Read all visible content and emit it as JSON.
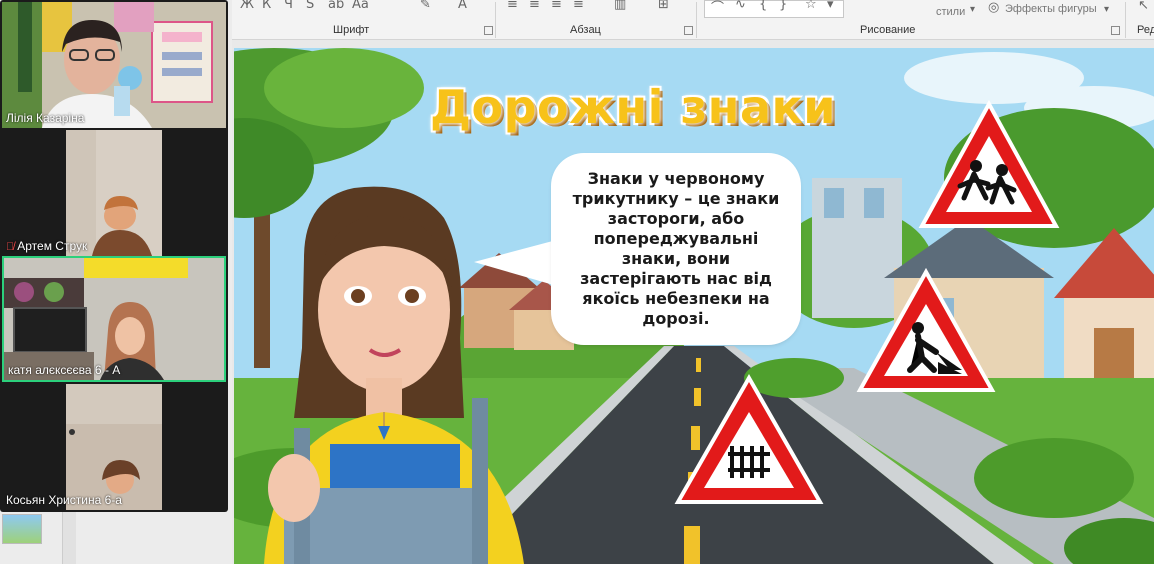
{
  "ribbon": {
    "groups": [
      {
        "label": "Шрифт"
      },
      {
        "label": "Абзац"
      },
      {
        "label": "Рисование"
      },
      {
        "label": "Ред"
      }
    ],
    "styles_label": "стили",
    "shape_effects_label": "Эффекты фигуры"
  },
  "participants": [
    {
      "name": "Лілія Казаріна",
      "muted": false,
      "active": false
    },
    {
      "name": "Артем Струк",
      "muted": true,
      "active": false
    },
    {
      "name": "катя алєксєєва 6 - А",
      "muted": false,
      "active": true
    },
    {
      "name": "Косьян Христина 6-а",
      "muted": false,
      "active": false
    }
  ],
  "slide": {
    "title": "Дорожні знаки",
    "bubble_text": "Знаки у червоному трикутнику – це знаки застороги, або попереджувальні знаки, вони застерігають нас від якоїсь небезпеки на дорозі.",
    "signs": [
      "children-crossing-sign",
      "road-works-sign",
      "level-crossing-barrier-sign"
    ]
  },
  "colors": {
    "active_tile_border": "#2cd07c",
    "title": "#f7c21a",
    "sign_red": "#e21a1a"
  }
}
